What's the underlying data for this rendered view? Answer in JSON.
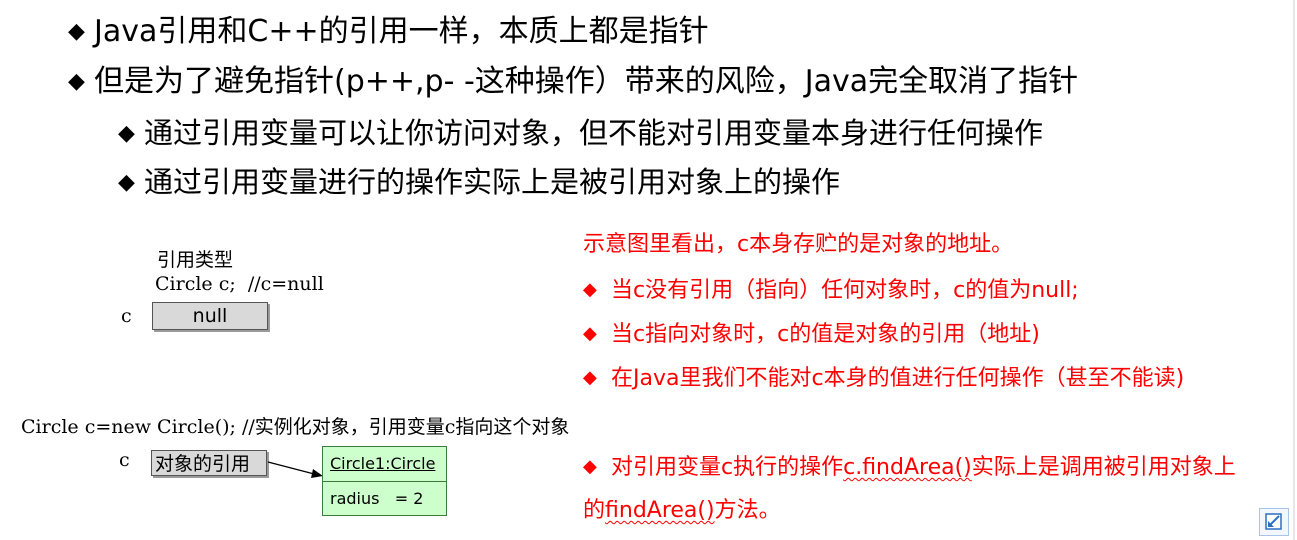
{
  "bullets": [
    "Java引用和C++的引用一样，本质上都是指针",
    "但是为了避免指针(p++,p- -这种操作）带来的风险，Java完全取消了指针"
  ],
  "sub_bullets": [
    "通过引用变量可以让你访问对象，但不能对引用变量本身进行任何操作",
    "通过引用变量进行的操作实际上是被引用对象上的操作"
  ],
  "diagram1": {
    "type_label": "引用类型",
    "code": "Circle c;  //c=null",
    "var_label": "c",
    "box_value": "null"
  },
  "diagram2": {
    "code": "Circle c=new Circle(); //实例化对象，引用变量c指向这个对象",
    "var_label": "c",
    "ref_box": "对象的引用",
    "object_header": "Circle1:Circle",
    "object_attr": "radius   = 2"
  },
  "notes": {
    "intro": "示意图里看出，c本身存贮的是对象的地址。",
    "items": [
      "当c没有引用（指向）任何对象时，c的值为null;",
      "当c指向对象时，c的值是对象的引用（地址)",
      "在Java里我们不能对c本身的值进行任何操作（甚至不能读)"
    ],
    "last_line1_prefix": "对引用变量c执行的操作",
    "last_line1_underlined": "c.findArea()",
    "last_line1_suffix": "实际上是调用被引用对象上",
    "last_line2_underlined": "findArea()",
    "last_line2_prefix": "的",
    "last_line2_suffix": "方法。"
  },
  "colors": {
    "note_red": "#ff0000",
    "object_fill": "#ccffcc",
    "box_grey": "#d9d9d9"
  },
  "icons": {
    "bullet": "black-diamond-icon",
    "corner": "corner-action-icon"
  }
}
